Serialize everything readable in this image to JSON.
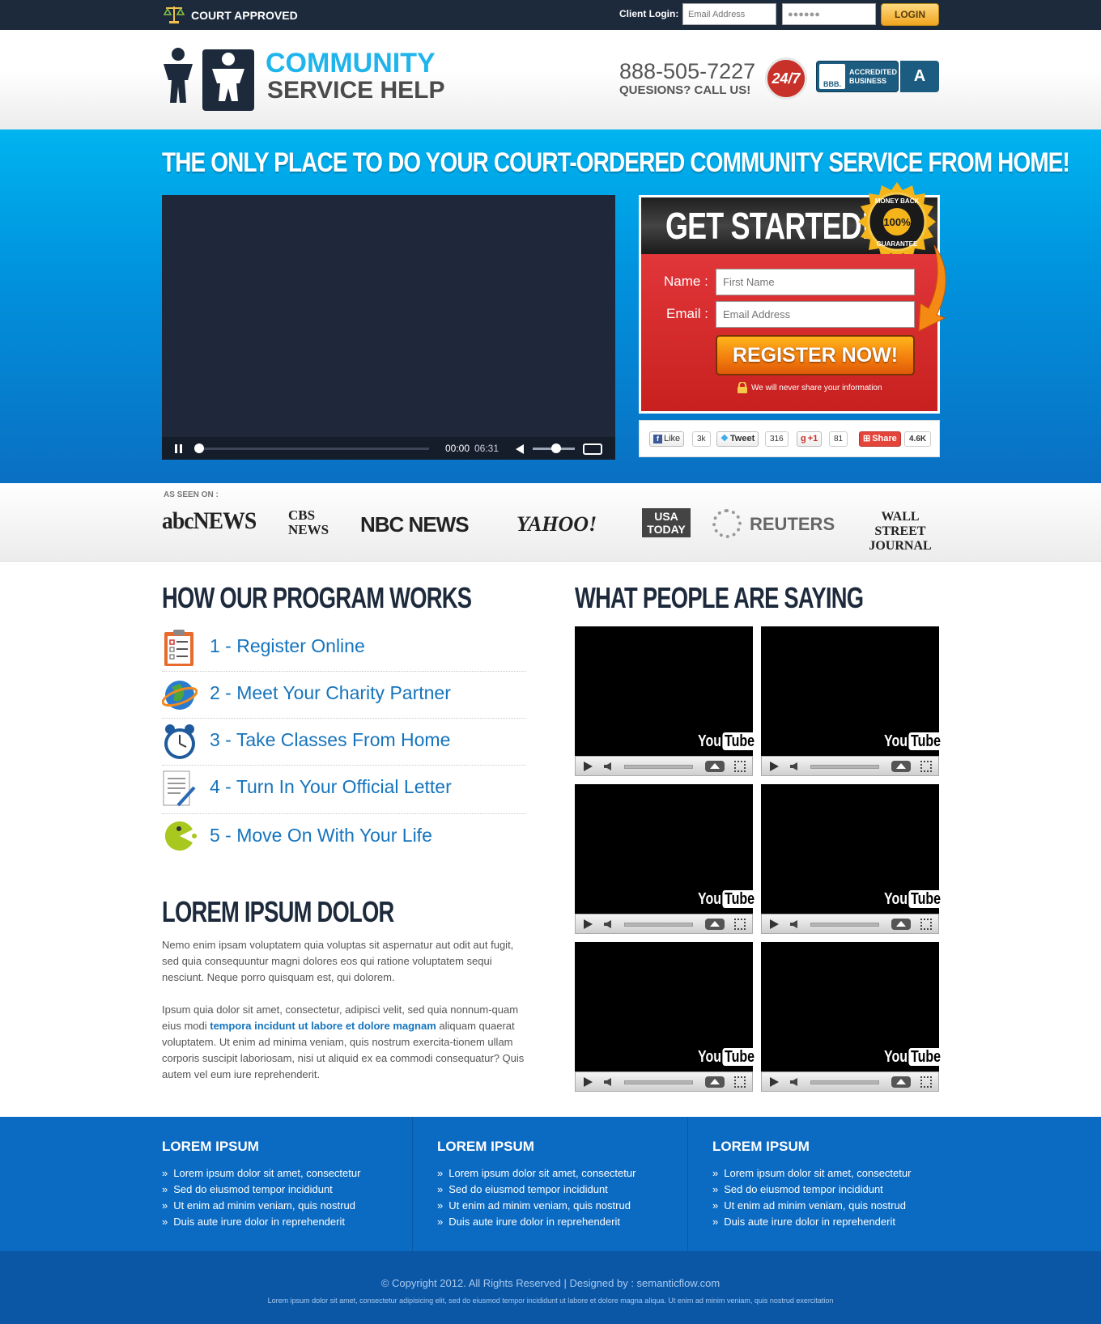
{
  "topbar": {
    "badge": "COURT APPROVED",
    "client_login_label": "Client Login:",
    "email_placeholder": "Email Address",
    "password_value": "●●●●●●",
    "login_button": "LOGIN"
  },
  "header": {
    "logo_line1": "COMMUNITY",
    "logo_line2": "SERVICE HELP",
    "phone": "888-505-7227",
    "phone_sub": "QUESIONS? CALL US!",
    "badge_247": "24/7",
    "bbb_logo": "BBB.",
    "bbb_text_1": "ACCREDITED",
    "bbb_text_2": "BUSINESS",
    "bbb_rating": "A"
  },
  "hero": {
    "title": "THE ONLY PLACE TO DO YOUR COURT-ORDERED COMMUNITY SERVICE FROM HOME!",
    "video": {
      "current_time": "00:00",
      "duration": "06:31",
      "progress": 0.0,
      "volume": 0.55
    },
    "form": {
      "heading": "GET STARTED!",
      "seal_top": "MONEY BACK",
      "seal_center": "100%",
      "seal_bottom": "GUARANTEE",
      "name_label": "Name :",
      "name_placeholder": "First Name",
      "email_label": "Email :",
      "email_placeholder": "Email Address",
      "submit": "REGISTER NOW!",
      "privacy_note": "We will never share your information"
    },
    "social": {
      "facebook_label": "Like",
      "facebook_count": "3k",
      "twitter_label": "Tweet",
      "twitter_count": "316",
      "google_label": "+1",
      "google_count": "81",
      "share_label": "Share",
      "share_count": "4.6K"
    }
  },
  "as_seen": {
    "label": "AS SEEN ON :",
    "outlets": [
      "abcNEWS",
      "CBS NEWS",
      "NBC NEWS",
      "YAHOO!",
      "USA TODAY",
      "REUTERS",
      "WALL STREET JOURNAL"
    ]
  },
  "how": {
    "title": "HOW OUR PROGRAM WORKS",
    "steps": [
      {
        "label": "1 - Register Online",
        "icon": "clipboard-icon"
      },
      {
        "label": "2 - Meet Your Charity Partner",
        "icon": "globe-icon"
      },
      {
        "label": "3 - Take Classes From Home",
        "icon": "clock-icon"
      },
      {
        "label": "4 - Turn In Your Official Letter",
        "icon": "document-pen-icon"
      },
      {
        "label": "5 - Move On With Your Life",
        "icon": "pacman-icon"
      }
    ]
  },
  "lorem": {
    "title": "LOREM IPSUM DOLOR",
    "para1": "Nemo enim ipsam voluptatem quia voluptas sit aspernatur aut odit aut fugit, sed quia consequuntur magni dolores eos qui ratione voluptatem sequi nesciunt. Neque porro quisquam est, qui dolorem.",
    "para2_a": "Ipsum quia dolor sit amet, consectetur, adipisci velit, sed quia nonnum-quam eius modi ",
    "para2_link": "tempora incidunt ut labore et dolore magnam",
    "para2_b": " aliquam quaerat voluptatem. Ut enim ad minima veniam, quis nostrum exercita-tionem ullam corporis suscipit laboriosam, nisi ut aliquid ex ea commodi consequatur? Quis autem vel eum iure reprehenderit."
  },
  "testimonials": {
    "title": "WHAT PEOPLE ARE SAYING",
    "logo_you": "You",
    "logo_tube": "Tube"
  },
  "footer": {
    "columns": [
      {
        "heading": "LOREM IPSUM",
        "items": [
          "Lorem ipsum dolor sit amet, consectetur",
          "Sed do eiusmod tempor incididunt",
          "Ut enim ad minim veniam, quis nostrud",
          "Duis aute irure dolor in reprehenderit"
        ]
      },
      {
        "heading": "LOREM IPSUM",
        "items": [
          "Lorem ipsum dolor sit amet, consectetur",
          "Sed do eiusmod tempor incididunt",
          "Ut enim ad minim veniam, quis nostrud",
          "Duis aute irure dolor in reprehenderit"
        ]
      },
      {
        "heading": "LOREM IPSUM",
        "items": [
          "Lorem ipsum dolor sit amet, consectetur",
          "Sed do eiusmod tempor incididunt",
          "Ut enim ad minim veniam, quis nostrud",
          "Duis aute irure dolor in reprehenderit"
        ]
      }
    ],
    "copyright": "© Copyright 2012. All Rights Reserved  |  Designed by : semanticflow.com",
    "fine_print": "Lorem ipsum dolor sit amet, consectetur adipisicing elit, sed do eiusmod tempor incididunt ut labore et dolore magna aliqua. Ut enim ad minim veniam, quis nostrud exercitation"
  },
  "colors": {
    "dark_navy": "#1d2a3c",
    "hero_blue": "#0093de",
    "accent_blue": "#1574bd",
    "form_red": "#d62a2c",
    "cta_orange": "#f27c0c"
  }
}
